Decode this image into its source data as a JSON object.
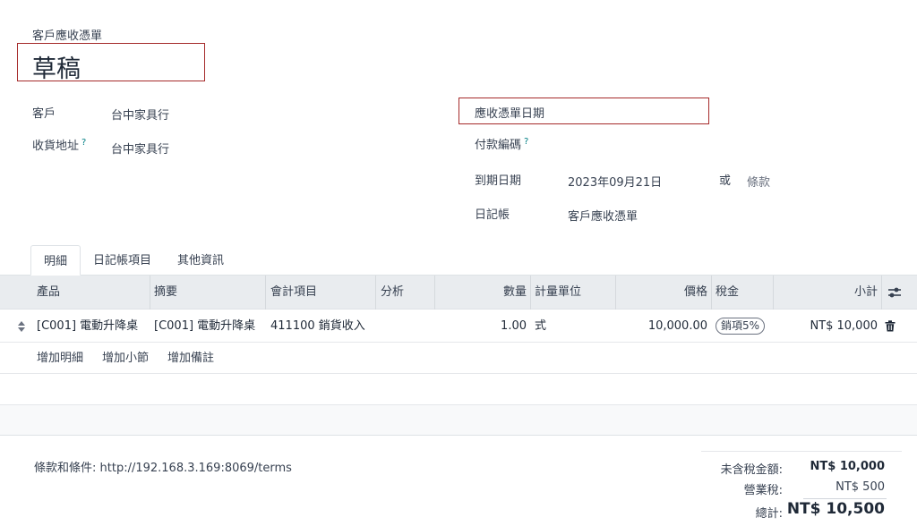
{
  "header": {
    "doc_type": "客戶應收憑單",
    "status_title": "草稿"
  },
  "left_fields": {
    "customer_label": "客戶",
    "customer_value": "台中家具行",
    "delivery_label": "收貨地址",
    "delivery_help": "?",
    "delivery_value": "台中家具行"
  },
  "right_fields": {
    "invoice_date_label": "應收憑單日期",
    "payment_ref_label": "付款編碼",
    "payment_ref_help": "?",
    "due_date_label": "到期日期",
    "due_date_value": "2023年09月21日",
    "or_text": "或",
    "terms_placeholder": "條款",
    "journal_label": "日記帳",
    "journal_value": "客戶應收憑單"
  },
  "tabs": [
    "明細",
    "日記帳項目",
    "其他資訊"
  ],
  "table": {
    "headers": [
      "產品",
      "摘要",
      "會計項目",
      "分析",
      "數量",
      "計量單位",
      "價格",
      "稅金",
      "小計"
    ],
    "rows": [
      {
        "product": "[C001] 電動升降桌",
        "description": "[C001] 電動升降桌",
        "account": "411100 銷貨收入",
        "analytic": "",
        "quantity": "1.00",
        "uom": "式",
        "price": "10,000.00",
        "tax": "銷項5%",
        "subtotal": "NT$ 10,000"
      }
    ],
    "add_links": [
      "增加明細",
      "增加小節",
      "增加備註"
    ]
  },
  "footer": {
    "terms": "條款和條件: http://192.168.3.169:8069/terms",
    "untaxed_label": "未含稅金額:",
    "untaxed_value": "NT$ 10,000",
    "tax_label": "營業稅:",
    "tax_value": "NT$ 500",
    "total_label": "總計:",
    "total_value": "NT$ 10,500"
  }
}
